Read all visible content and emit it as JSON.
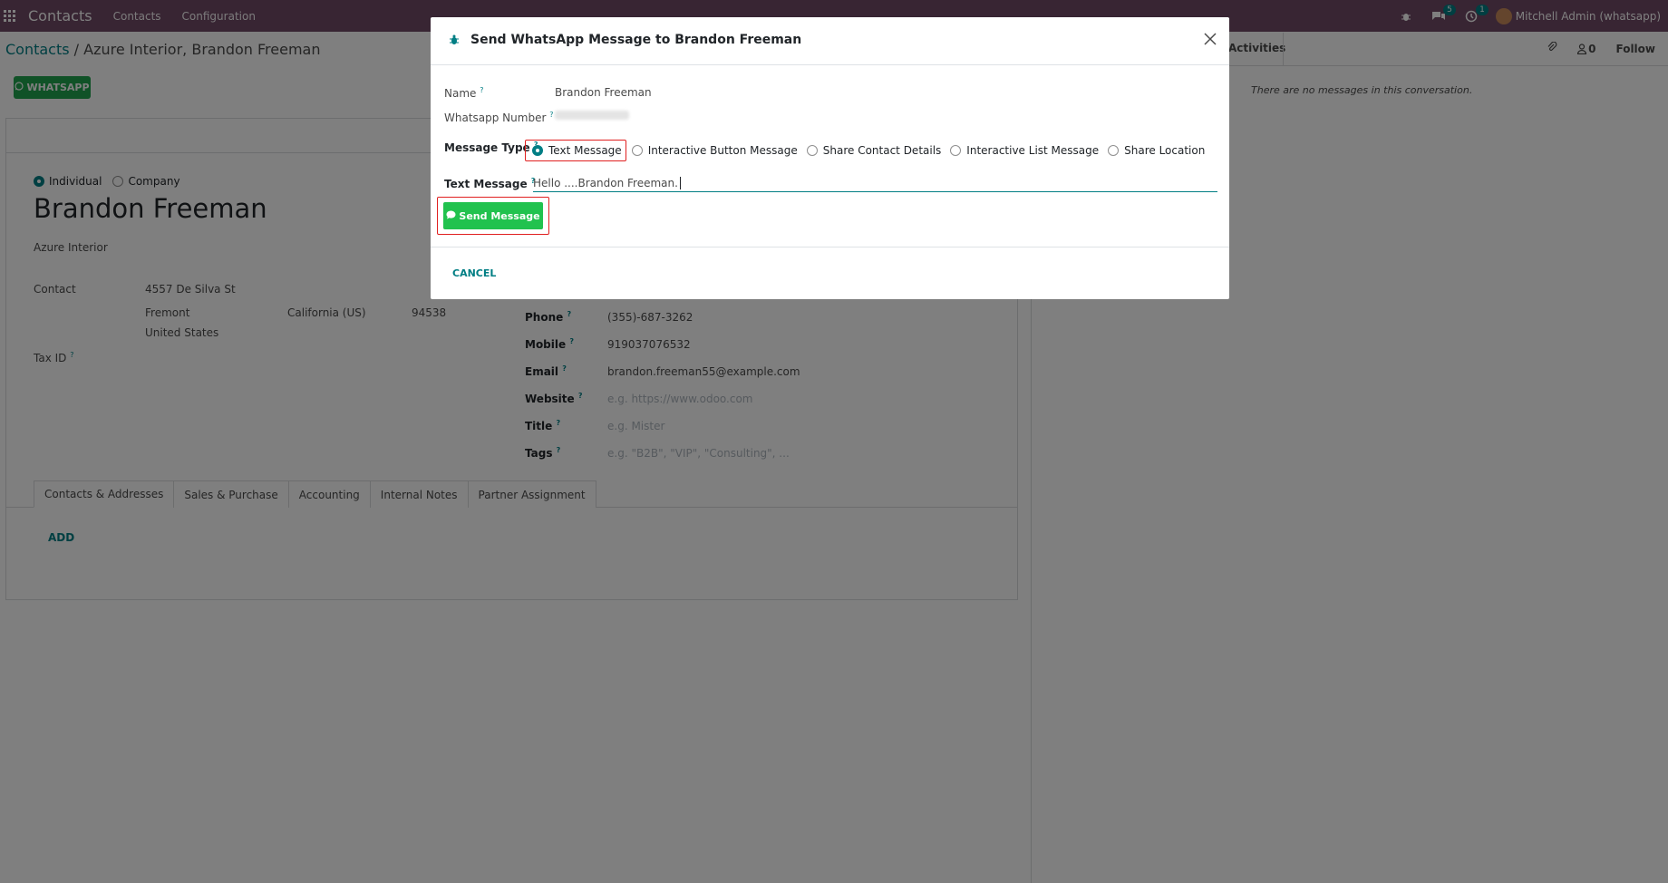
{
  "navbar": {
    "brand": "Contacts",
    "menu": [
      "Contacts",
      "Configuration"
    ],
    "messages_badge": "5",
    "activities_badge": "1",
    "user": "Mitchell Admin (whatsapp)"
  },
  "control_panel": {
    "breadcrumb_root": "Contacts",
    "breadcrumb_sep": " / ",
    "breadcrumb_current": "Azure Interior, Brandon Freeman",
    "whatsapp_button": "WHATSAPP"
  },
  "form": {
    "company_type_options": [
      "Individual",
      "Company"
    ],
    "name": "Brandon Freeman",
    "company": "Azure Interior",
    "contact_label": "Contact",
    "street": "4557 De Silva St",
    "city": "Fremont",
    "state": "California (US)",
    "zip": "94538",
    "country": "United States",
    "tax_id_label": "Tax ID",
    "phone_label": "Phone",
    "phone": "(355)-687-3262",
    "mobile_label": "Mobile",
    "mobile": "919037076532",
    "email_label": "Email",
    "email": "brandon.freeman55@example.com",
    "website_label": "Website",
    "website_placeholder": "e.g. https://www.odoo.com",
    "title_label": "Title",
    "title_placeholder": "e.g. Mister",
    "tags_label": "Tags",
    "tags_placeholder": "e.g. \"B2B\", \"VIP\", \"Consulting\", ...",
    "tabs": [
      "Contacts & Addresses",
      "Sales & Purchase",
      "Accounting",
      "Internal Notes",
      "Partner Assignment"
    ],
    "add_link": "ADD",
    "help_mark": "?"
  },
  "chatter": {
    "activities": "Activities",
    "followers_count": "0",
    "follow": "Follow",
    "empty_message": "There are no messages in this conversation."
  },
  "modal": {
    "title": "Send WhatsApp Message to Brandon Freeman",
    "name_label": "Name",
    "name_value": "Brandon Freeman",
    "number_label": "Whatsapp Number",
    "type_label": "Message Type",
    "types": [
      "Text Message",
      "Interactive Button Message",
      "Share Contact Details",
      "Interactive List Message",
      "Share Location"
    ],
    "text_label": "Text Message",
    "text_value": "Hello ....Brandon Freeman.",
    "send_button": "Send Message",
    "cancel_button": "CANCEL"
  }
}
